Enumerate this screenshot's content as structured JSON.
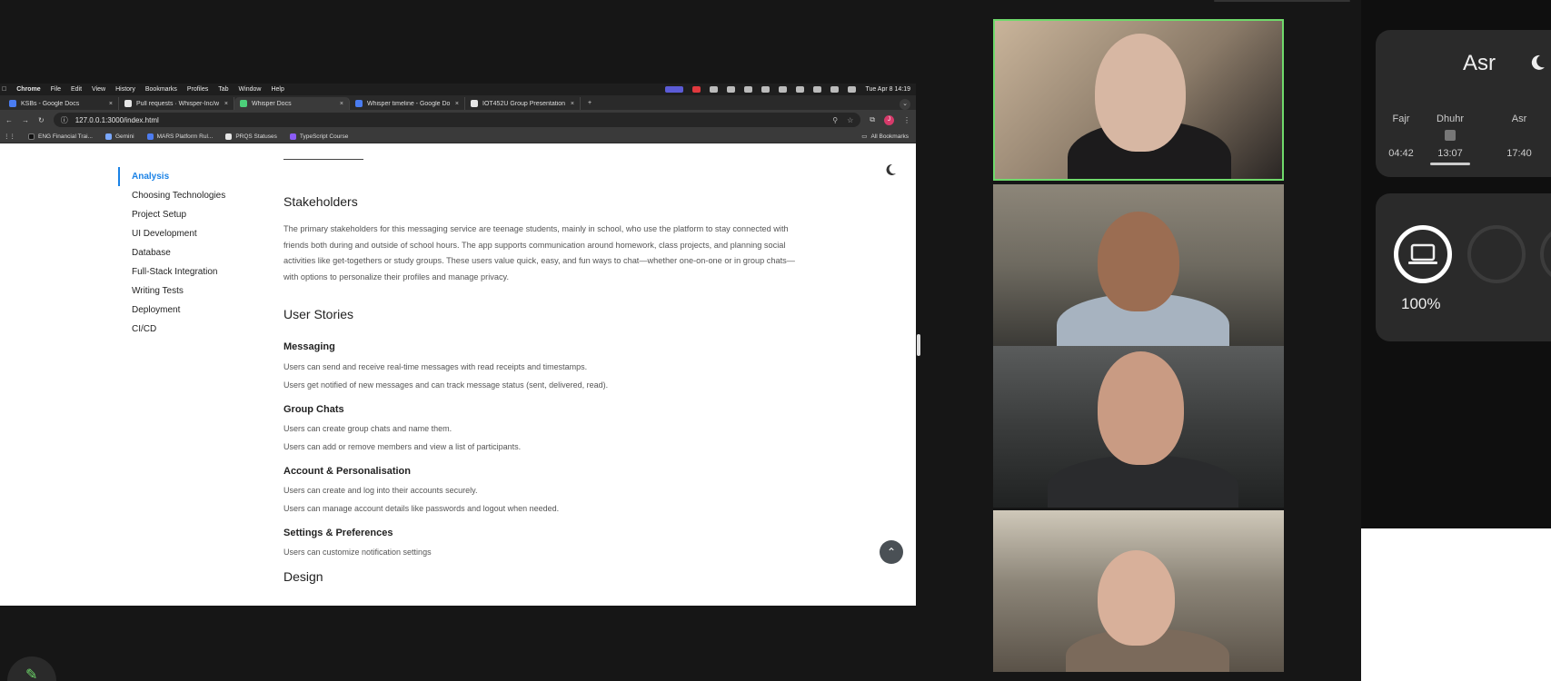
{
  "menubar": {
    "items": [
      "Chrome",
      "File",
      "Edit",
      "View",
      "History",
      "Bookmarks",
      "Profiles",
      "Tab",
      "Window",
      "Help"
    ],
    "clock": "Tue Apr 8  14:19"
  },
  "tabs": [
    {
      "title": "KSBs - Google Docs",
      "color": "#4a7cf0"
    },
    {
      "title": "Pull requests · Whisper-Inc/w",
      "color": "#e6e6e6"
    },
    {
      "title": "Whisper Docs",
      "color": "#4ccf7a"
    },
    {
      "title": "Whisper timeline - Google Do",
      "color": "#4a7cf0"
    },
    {
      "title": "IOT452U Group Presentation",
      "color": "#e6e6e6"
    }
  ],
  "url": "127.0.0.1:3000/index.html",
  "bookmarks": [
    "ENG Financial Trai...",
    "Gemini",
    "MARS Platform Rul...",
    "PRQS Statuses",
    "TypeScript Course"
  ],
  "bookmarks_all": "All Bookmarks",
  "sidenav": {
    "items": [
      "Analysis",
      "Choosing Technologies",
      "Project Setup",
      "UI Development",
      "Database",
      "Full-Stack Integration",
      "Writing Tests",
      "Deployment",
      "CI/CD"
    ]
  },
  "doc": {
    "stakeholders_title": "Stakeholders",
    "stakeholders_para": "The primary stakeholders for this messaging service are teenage students, mainly in school, who use the platform to stay connected with friends both during and outside of school hours. The app supports communication around homework, class projects, and planning social activities like get-togethers or study groups. These users value quick, easy, and fun ways to chat—whether one-on-one or in group chats—with options to personalize their profiles and manage privacy.",
    "user_stories_title": "User Stories",
    "messaging_title": "Messaging",
    "messaging_1": "Users can send and receive real-time messages with read receipts and timestamps.",
    "messaging_2": "Users get notified of new messages and can track message status (sent, delivered, read).",
    "group_title": "Group Chats",
    "group_1": "Users can create group chats and name them.",
    "group_2": "Users can add or remove members and view a list of participants.",
    "account_title": "Account & Personalisation",
    "account_1": "Users can create and log into their accounts securely.",
    "account_2": "Users can manage account details like passwords and logout when needed.",
    "settings_title": "Settings & Preferences",
    "settings_1": "Users can customize notification settings",
    "design_title": "Design"
  },
  "prayer": {
    "current": "Asr",
    "times": [
      {
        "name": "Fajr",
        "time": "04:42"
      },
      {
        "name": "Dhuhr",
        "time": "13:07"
      },
      {
        "name": "Asr",
        "time": "17:40"
      }
    ]
  },
  "battery": {
    "percent": "100%",
    "level": 1.0
  }
}
